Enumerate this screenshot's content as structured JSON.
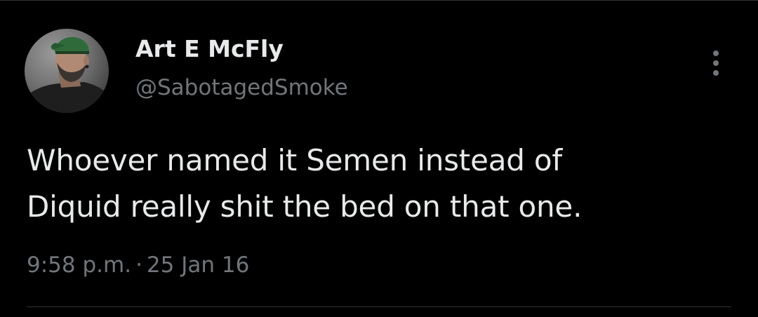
{
  "tweet": {
    "display_name": "Art E McFly",
    "handle": "@SabotagedSmoke",
    "text_lines": [
      "Whoever named it Semen instead of",
      "Diquid really shit the bed on that one."
    ],
    "time": "9:58 p.m.",
    "separator": "·",
    "date": "25 Jan 16"
  },
  "icons": {
    "more": "more-vertical-icon",
    "avatar": "profile-photo"
  },
  "colors": {
    "background": "#000000",
    "primary_text": "#e7e9ea",
    "secondary_text": "#71767b",
    "divider": "#2f3336"
  }
}
